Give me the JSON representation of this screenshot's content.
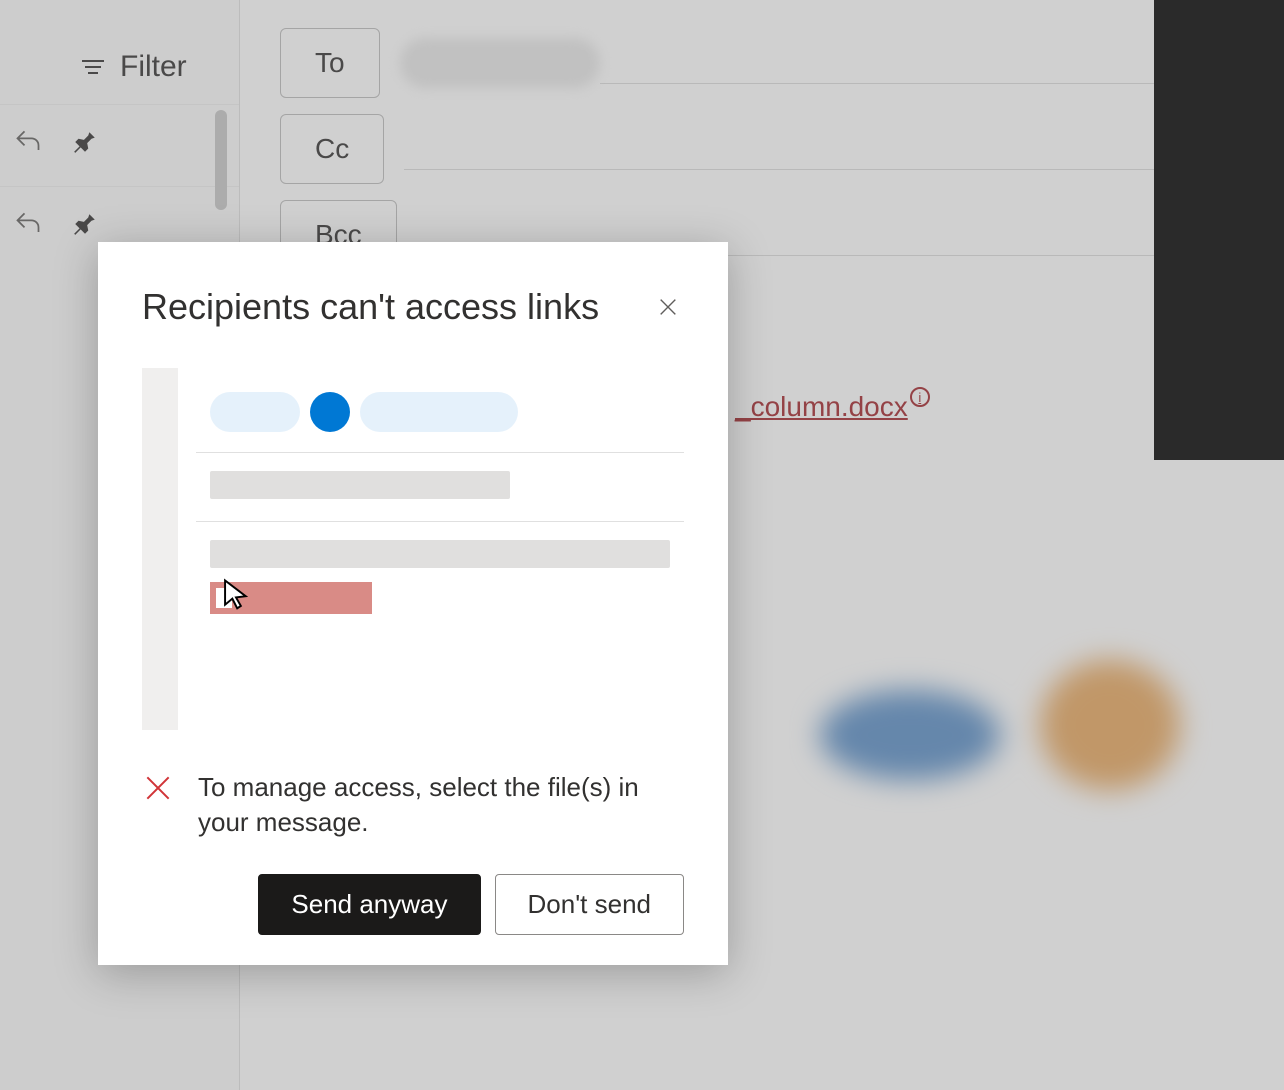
{
  "sidebar": {
    "filter_label": "Filter"
  },
  "compose": {
    "to_label": "To",
    "cc_label": "Cc",
    "bcc_label": "Bcc",
    "attachment_name": "_column.docx"
  },
  "modal": {
    "title": "Recipients can't access links",
    "warning_text": "To manage access, select the file(s) in your message.",
    "send_anyway_label": "Send anyway",
    "dont_send_label": "Don't send"
  }
}
